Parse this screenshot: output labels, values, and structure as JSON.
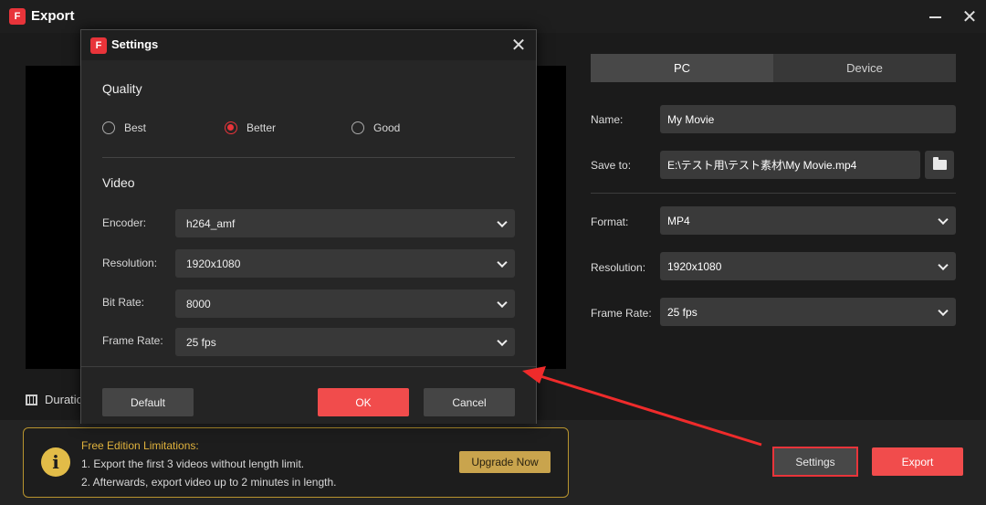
{
  "window": {
    "title": "Export",
    "logo": "app-logo-icon"
  },
  "preview": {
    "duration_label": "Duration"
  },
  "right_panel": {
    "tabs": [
      {
        "label": "PC",
        "active": true
      },
      {
        "label": "Device",
        "active": false
      }
    ],
    "name_label": "Name:",
    "name_value": "My Movie",
    "save_to_label": "Save to:",
    "save_to_value": "E:\\テスト用\\テスト素材\\My Movie.mp4",
    "format_label": "Format:",
    "format_value": "MP4",
    "resolution_label": "Resolution:",
    "resolution_value": "1920x1080",
    "frame_rate_label": "Frame Rate:",
    "frame_rate_value": "25 fps"
  },
  "limitations": {
    "title": "Free Edition Limitations:",
    "line1": "1. Export the first 3 videos without length limit.",
    "line2": "2. Afterwards, export video up to 2 minutes in length.",
    "upgrade_label": "Upgrade Now"
  },
  "actions": {
    "settings_label": "Settings",
    "export_label": "Export"
  },
  "settings_dialog": {
    "title": "Settings",
    "quality_heading": "Quality",
    "quality_options": [
      {
        "label": "Best",
        "selected": false
      },
      {
        "label": "Better",
        "selected": true
      },
      {
        "label": "Good",
        "selected": false
      }
    ],
    "video_heading": "Video",
    "encoder_label": "Encoder:",
    "encoder_value": "h264_amf",
    "resolution_label": "Resolution:",
    "resolution_value": "1920x1080",
    "bit_rate_label": "Bit Rate:",
    "bit_rate_value": "8000",
    "frame_rate_label": "Frame Rate:",
    "frame_rate_value": "25 fps",
    "default_label": "Default",
    "ok_label": "OK",
    "cancel_label": "Cancel"
  },
  "colors": {
    "accent": "#f14c4c",
    "highlight_border": "#e8343a",
    "warning": "#e0b23c",
    "upgrade": "#c9a44d"
  }
}
